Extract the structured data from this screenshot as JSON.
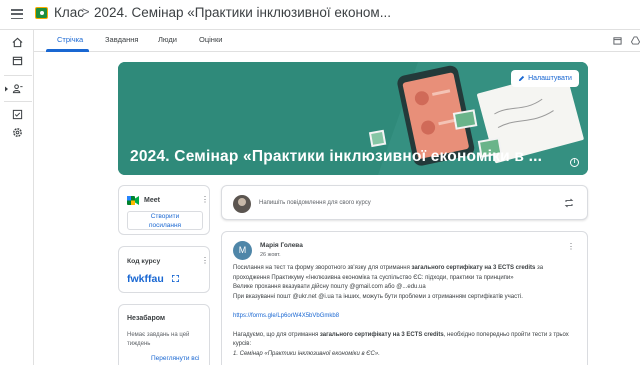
{
  "header": {
    "brand": "Клас",
    "separator": ">",
    "course_title": "2024. Семінар «Практики інклюзивної економ..."
  },
  "tabs": [
    {
      "label": "Стрічка",
      "active": true
    },
    {
      "label": "Завдання",
      "active": false
    },
    {
      "label": "Люди",
      "active": false
    },
    {
      "label": "Оцінки",
      "active": false
    }
  ],
  "banner": {
    "title": "2024. Семінар «Практики інклюзивної економіки в ...",
    "customize_label": "Налаштувати"
  },
  "meet": {
    "label": "Meet",
    "button_line1": "Створити",
    "button_line2": "посилання"
  },
  "course_code": {
    "label": "Код курсу",
    "value": "fwkffau"
  },
  "upcoming": {
    "title": "Незабаром",
    "text": "Немає завдань на цей тиждень",
    "link": "Переглянути всі"
  },
  "announce": {
    "placeholder": "Напишіть повідомлення для свого курсу"
  },
  "post": {
    "avatar_letter": "M",
    "author": "Марія Голева",
    "date": "26 жовт.",
    "p1_a": "Посилання на тест та форму зворотного зв'язку для отримання ",
    "p1_b": "загального сертифікату на 3 ECTS credits",
    "p1_c": " за",
    "p2": "проходження  Практикуму «Інклюзивна економіка та суспільство ЄС: підходи, практики та принципи»",
    "p3": "Велике прохання вказувати дійсну пошту  @gmail.com або @...edu.ua",
    "p4": "При вказуванні пошт  @ukr.net  @i.ua та інших, можуть бути проблеми з отриманням сертифікатів участі.",
    "link": "https://forms.gle/Lp6orW4X5bVbGmkb8",
    "p5_a": "Нагадуємо, що для отримання ",
    "p5_b": "загального сертифікату на 3 ECTS credits",
    "p5_c": ", необхідно попередньо пройти тести з трьох",
    "p6": "курсів:",
    "p7": "1. Семінар «Практики інклюзивної економіки в ЄС»."
  },
  "colors": {
    "accent": "#1967d2",
    "banner": "#2f8a7a"
  },
  "icons": {
    "rail": [
      "home-icon",
      "calendar-icon",
      "enrolled-icon",
      "todo-icon",
      "settings-icon"
    ],
    "tabs_right": [
      "calendar-icon",
      "drive-icon"
    ]
  }
}
